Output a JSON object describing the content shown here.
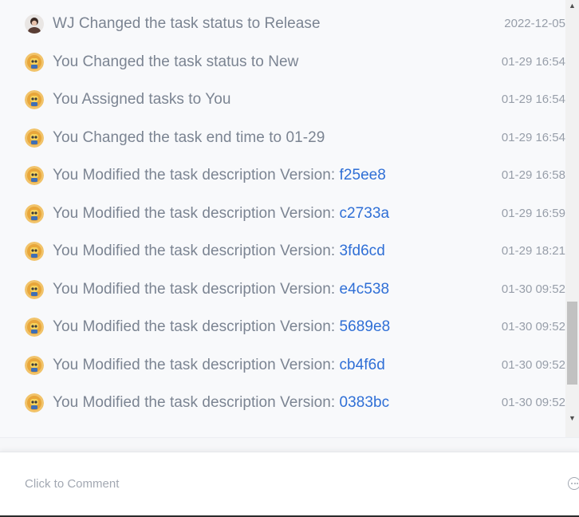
{
  "activity": [
    {
      "avatar": "wj-photo",
      "text": "WJ Changed the task status to Release",
      "version": "",
      "time": "2022-12-05"
    },
    {
      "avatar": "you-cartoon",
      "text": "You Changed the task status to New",
      "version": "",
      "time": "01-29 16:54"
    },
    {
      "avatar": "you-cartoon",
      "text": "You Assigned tasks to You",
      "version": "",
      "time": "01-29 16:54"
    },
    {
      "avatar": "you-cartoon",
      "text": "You Changed the task end time to 01-29",
      "version": "",
      "time": "01-29 16:54"
    },
    {
      "avatar": "you-cartoon",
      "text": "You Modified the task description Version: ",
      "version": "f25ee8",
      "time": "01-29 16:58"
    },
    {
      "avatar": "you-cartoon",
      "text": "You Modified the task description Version: ",
      "version": "c2733a",
      "time": "01-29 16:59"
    },
    {
      "avatar": "you-cartoon",
      "text": "You Modified the task description Version: ",
      "version": "3fd6cd",
      "time": "01-29 18:21"
    },
    {
      "avatar": "you-cartoon",
      "text": "You Modified the task description Version: ",
      "version": "e4c538",
      "time": "01-30 09:52"
    },
    {
      "avatar": "you-cartoon",
      "text": "You Modified the task description Version: ",
      "version": "5689e8",
      "time": "01-30 09:52"
    },
    {
      "avatar": "you-cartoon",
      "text": "You Modified the task description Version: ",
      "version": "cb4f6d",
      "time": "01-30 09:52"
    },
    {
      "avatar": "you-cartoon",
      "text": "You Modified the task description Version: ",
      "version": "0383bc",
      "time": "01-30 09:52"
    }
  ],
  "comment": {
    "placeholder": "Click to Comment",
    "icon": "more-dots-icon"
  },
  "colors": {
    "text": "#7b8492",
    "version_link": "#2f6fd6",
    "time": "#979ea9",
    "feed_bg": "#f8f9fb"
  },
  "scrollbar": {
    "position_fraction": 0.78
  }
}
